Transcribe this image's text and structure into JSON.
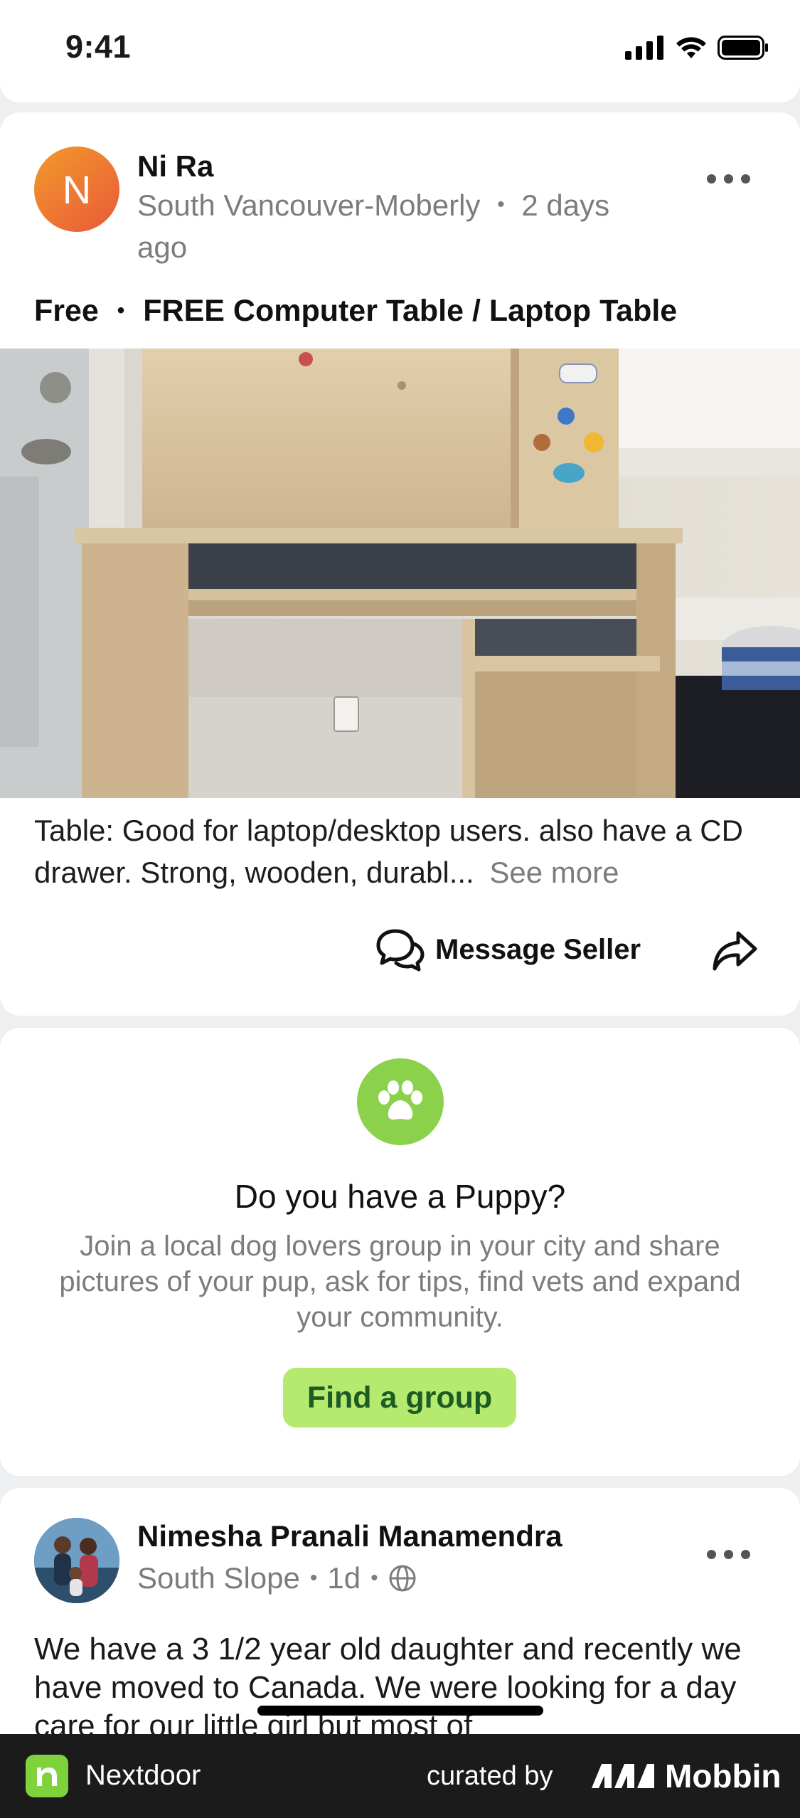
{
  "status_bar": {
    "time": "9:41"
  },
  "listing_post": {
    "avatar_letter": "N",
    "author": "Ni Ra",
    "location": "South Vancouver-Moberly",
    "separator": "•",
    "time_ago_part1": "2 days",
    "time_ago_part2": "ago",
    "price": "Free",
    "title_separator": "•",
    "title": "FREE Computer Table / Laptop Table",
    "description": "Table: Good for laptop/desktop users. also have a CD drawer. Strong, wooden, durabl...",
    "see_more": "See more",
    "message_button": "Message Seller",
    "icons": [
      "more-options-icon",
      "chat-bubbles-icon",
      "share-arrow-icon"
    ]
  },
  "promo_card": {
    "icon": "paw-icon",
    "title": "Do you have a Puppy?",
    "body": "Join a local dog lovers group in your city and share pictures of your pup, ask for tips, find vets and expand your community.",
    "button": "Find a group",
    "colors": {
      "accent": "#8bd14b",
      "button_bg": "#b5ea6e",
      "button_text": "#1d5b25"
    }
  },
  "feed_post": {
    "author": "Nimesha Pranali Manamendra",
    "location": "South Slope",
    "separator": "•",
    "time_ago": "1d",
    "visibility_icon": "globe-icon",
    "body": "We have a 3 1/2  year old daughter and  recently we have moved to Canada. We were looking for a day care for our little girl but most of"
  },
  "brand_bar": {
    "app_name": "Nextdoor",
    "curated_by": "curated by",
    "curator": "Mobbin"
  }
}
